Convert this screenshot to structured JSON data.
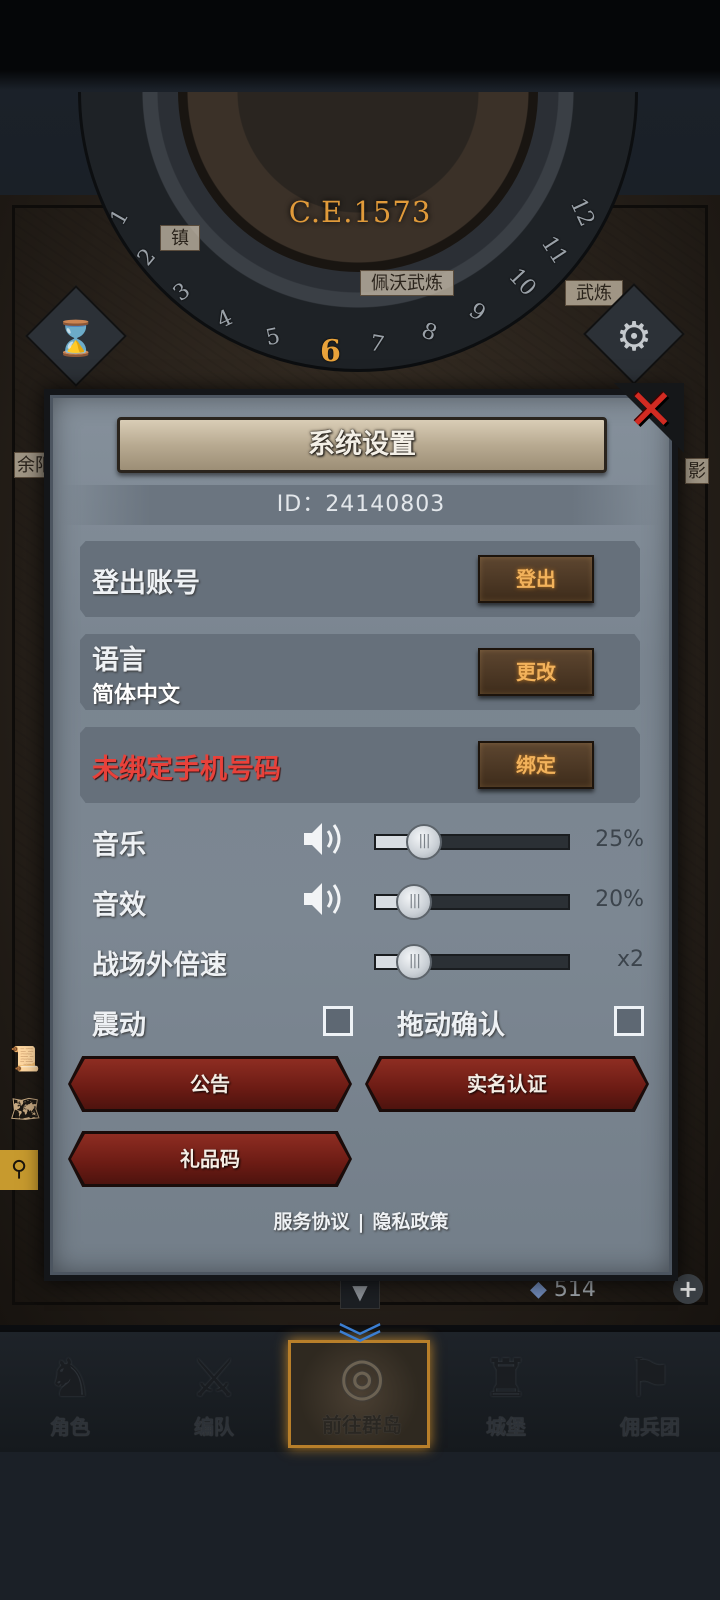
{
  "top": {
    "year": "C.E.1573",
    "dial_numbers": [
      "1",
      "2",
      "3",
      "4",
      "5",
      "6",
      "7",
      "8",
      "9",
      "10",
      "11",
      "12"
    ],
    "active_number": "6",
    "map_labels": [
      "镇",
      "佩沃武炼",
      "武炼",
      "余阳",
      "影"
    ]
  },
  "dialog": {
    "title": "系统设置",
    "close_icon": "close-x-icon",
    "id_text": "ID：24140803",
    "logout": {
      "label": "登出账号",
      "button": "登出"
    },
    "language": {
      "label": "语言",
      "value": "简体中文",
      "button": "更改"
    },
    "phone": {
      "label": "未绑定手机号码",
      "button": "绑定",
      "label_color": "#e8413a"
    },
    "music": {
      "label": "音乐",
      "value_text": "25%",
      "level": 0.25
    },
    "sfx": {
      "label": "音效",
      "value_text": "20%",
      "level": 0.2
    },
    "battle_speed": {
      "label": "战场外倍速",
      "value_text": "x2",
      "level": 0.2
    },
    "vibration": {
      "label": "震动",
      "checked": false
    },
    "drag_confirm": {
      "label": "拖动确认",
      "checked": false
    },
    "buttons": {
      "announcement": "公告",
      "realname": "实名认证",
      "gift_code": "礼品码"
    },
    "footer": {
      "terms": "服务协议",
      "separator": "|",
      "privacy": "隐私政策"
    }
  },
  "map_overlay": {
    "resource_value": "514"
  },
  "bottom_nav": {
    "items": [
      {
        "label": "角色",
        "icon": "knight-helmet-icon"
      },
      {
        "label": "编队",
        "icon": "formation-icon"
      },
      {
        "label": "前往群岛",
        "icon": "compass-island-icon",
        "active": true
      },
      {
        "label": "城堡",
        "icon": "castle-icon"
      },
      {
        "label": "佣兵团",
        "icon": "mercenary-icon"
      }
    ]
  },
  "colors": {
    "accent_gold": "#f2b25b",
    "button_red": "#8e2d22",
    "panel_gray": "#7a8590",
    "active_nav_border": "#b87f2a"
  }
}
